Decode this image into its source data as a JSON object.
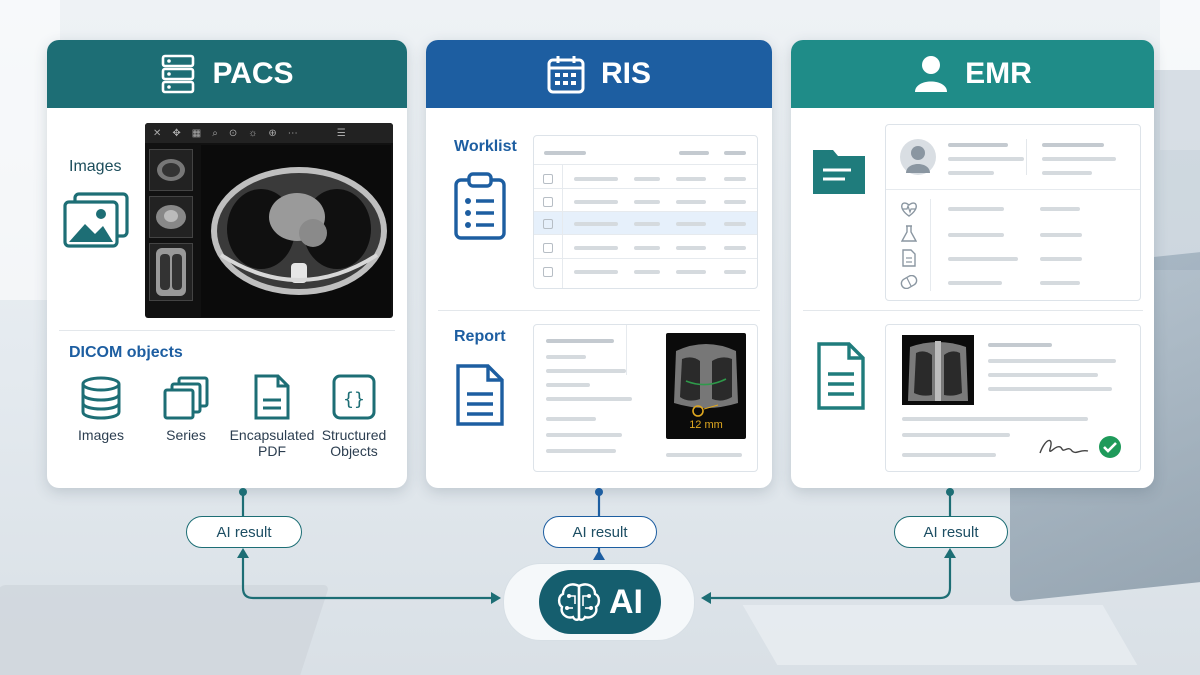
{
  "pacs": {
    "title": "PACS",
    "icon": "server-icon",
    "images_label": "Images",
    "dicom_label": "DICOM objects",
    "objects": [
      {
        "label": "Images",
        "icon": "database-icon"
      },
      {
        "label": "Series",
        "icon": "stack-icon"
      },
      {
        "label": "Encapsulated PDF",
        "icon": "document-icon"
      },
      {
        "label": "Structured Objects",
        "icon": "braces-icon"
      }
    ]
  },
  "ris": {
    "title": "RIS",
    "icon": "calendar-icon",
    "worklist_label": "Worklist",
    "report_label": "Report",
    "measurement": "12 mm"
  },
  "emr": {
    "title": "EMR",
    "icon": "user-icon"
  },
  "ai": {
    "label": "AI",
    "result_label": "AI result"
  },
  "colors": {
    "pacs": "#1d6e75",
    "ris": "#1d5ea1",
    "emr": "#1f8c88",
    "ai": "#155e6e",
    "check": "#1e9a5a"
  }
}
